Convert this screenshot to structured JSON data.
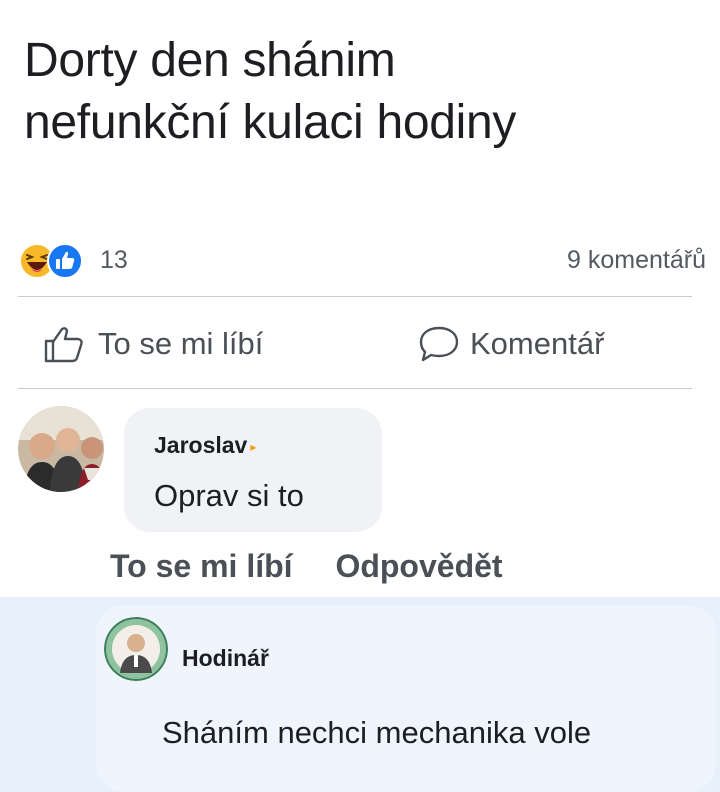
{
  "post": {
    "text_line1": "Dorty den shánim",
    "text_line2": "nefunkční kulaci hodiny"
  },
  "stats": {
    "reaction_count": "13",
    "comments_count": "9 komentářů",
    "reaction_icons": [
      "haha-reaction-icon",
      "like-reaction-icon"
    ]
  },
  "actions": {
    "like_label": "To se mi líbí",
    "comment_label": "Komentář"
  },
  "comment": {
    "author": "Jaroslav",
    "text": "Oprav si to",
    "like_label": "To se mi líbí",
    "reply_label": "Odpovědět"
  },
  "reply": {
    "author": "Hodinář",
    "text": "Sháním nechci mechanika vole"
  },
  "colors": {
    "text": "#1c1e21",
    "muted": "#4b4f56",
    "divider": "#c9ccd1",
    "bubble": "#f0f2f5",
    "reply_bg": "#e6f1fb",
    "like_blue": "#1877f2",
    "haha_yellow": "#f7b928"
  }
}
